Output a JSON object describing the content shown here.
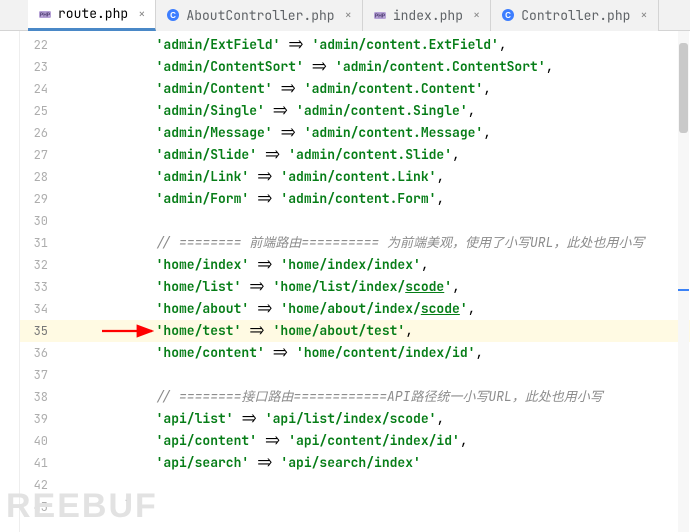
{
  "tabs": [
    {
      "label": "route.php",
      "icon": "php",
      "active": true
    },
    {
      "label": "AboutController.php",
      "icon": "ctrl",
      "active": false
    },
    {
      "label": "index.php",
      "icon": "php",
      "active": false
    },
    {
      "label": "Controller.php",
      "icon": "ctrl",
      "active": false
    }
  ],
  "lines": {
    "22": {
      "indent": "            ",
      "key": "'admin/ExtField'",
      "val": "'admin/content.ExtField'",
      "comma": ","
    },
    "23": {
      "indent": "            ",
      "key": "'admin/ContentSort'",
      "val": "'admin/content.ContentSort'",
      "comma": ","
    },
    "24": {
      "indent": "            ",
      "key": "'admin/Content'",
      "val": "'admin/content.Content'",
      "comma": ","
    },
    "25": {
      "indent": "            ",
      "key": "'admin/Single'",
      "val": "'admin/content.Single'",
      "comma": ","
    },
    "26": {
      "indent": "            ",
      "key": "'admin/Message'",
      "val": "'admin/content.Message'",
      "comma": ","
    },
    "27": {
      "indent": "            ",
      "key": "'admin/Slide'",
      "val": "'admin/content.Slide'",
      "comma": ","
    },
    "28": {
      "indent": "            ",
      "key": "'admin/Link'",
      "val": "'admin/content.Link'",
      "comma": ","
    },
    "29": {
      "indent": "            ",
      "key": "'admin/Form'",
      "val": "'admin/content.Form'",
      "comma": ","
    },
    "31": {
      "indent": "            ",
      "comment": "// ======== 前端路由========== 为前端美观，使用了小写URL，此处也用小写"
    },
    "32": {
      "indent": "            ",
      "key": "'home/index'",
      "val": "'home/index/index'",
      "comma": ","
    },
    "33": {
      "indent": "            ",
      "key": "'home/list'",
      "valp": "'home/list/index/",
      "ul": "scode",
      "valrest": "'",
      "comma": ","
    },
    "34": {
      "indent": "            ",
      "key": "'home/about'",
      "valp": "'home/about/index/",
      "ul": "scode",
      "valrest": "'",
      "comma": ","
    },
    "35": {
      "indent": "            ",
      "key": "'home/test'",
      "val": "'home/about/test'",
      "comma": ",",
      "hl": true
    },
    "36": {
      "indent": "            ",
      "key": "'home/content'",
      "val": "'home/content/index/id'",
      "comma": ","
    },
    "38": {
      "indent": "            ",
      "comment": "// ========接口路由============API路径统一小写URL，此处也用小写"
    },
    "39": {
      "indent": "            ",
      "key": "'api/list'",
      "val": "'api/list/index/scode'",
      "comma": ","
    },
    "40": {
      "indent": "            ",
      "key": "'api/content'",
      "val": "'api/content/index/id'",
      "comma": ","
    },
    "41": {
      "indent": "            ",
      "key": "'api/search'",
      "val": "'api/search/index'"
    },
    "43": {
      "indent": "        ",
      "plain": ")"
    }
  },
  "line_numbers": [
    "22",
    "23",
    "24",
    "25",
    "26",
    "27",
    "28",
    "29",
    "30",
    "31",
    "32",
    "33",
    "34",
    "35",
    "36",
    "37",
    "38",
    "39",
    "40",
    "41",
    "42",
    "43"
  ],
  "arrow_op": " => ",
  "arrow_line": "35",
  "watermark": "REEBUF",
  "highlight_line": "35"
}
